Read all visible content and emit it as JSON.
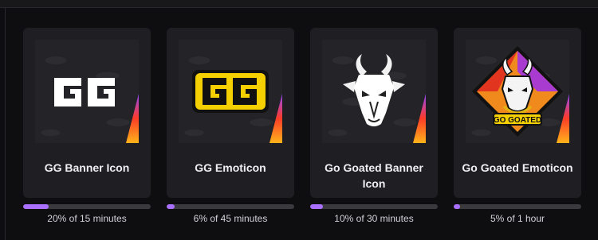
{
  "rewards": [
    {
      "title": "GG Banner Icon",
      "progress_text": "20% of 15 minutes",
      "progress": 0.2,
      "icon": "gg-banner-icon"
    },
    {
      "title": "GG Emoticon",
      "progress_text": "6% of 45 minutes",
      "progress": 0.06,
      "icon": "gg-emoticon-icon"
    },
    {
      "title": "Go Goated Banner Icon",
      "progress_text": "10% of 30 minutes",
      "progress": 0.1,
      "icon": "goat-head-icon"
    },
    {
      "title": "Go Goated Emoticon",
      "progress_text": "5% of 1 hour",
      "progress": 0.05,
      "icon": "go-goated-emoticon-icon",
      "badge_text": "GO GOATED"
    }
  ],
  "colors": {
    "accent": "#a970ff",
    "card": "#1f1f23",
    "background": "#0e0e10",
    "emote_yellow": "#f5d000",
    "corner_gradient": [
      "#9146ff",
      "#ff3c28",
      "#ffb31a"
    ]
  }
}
